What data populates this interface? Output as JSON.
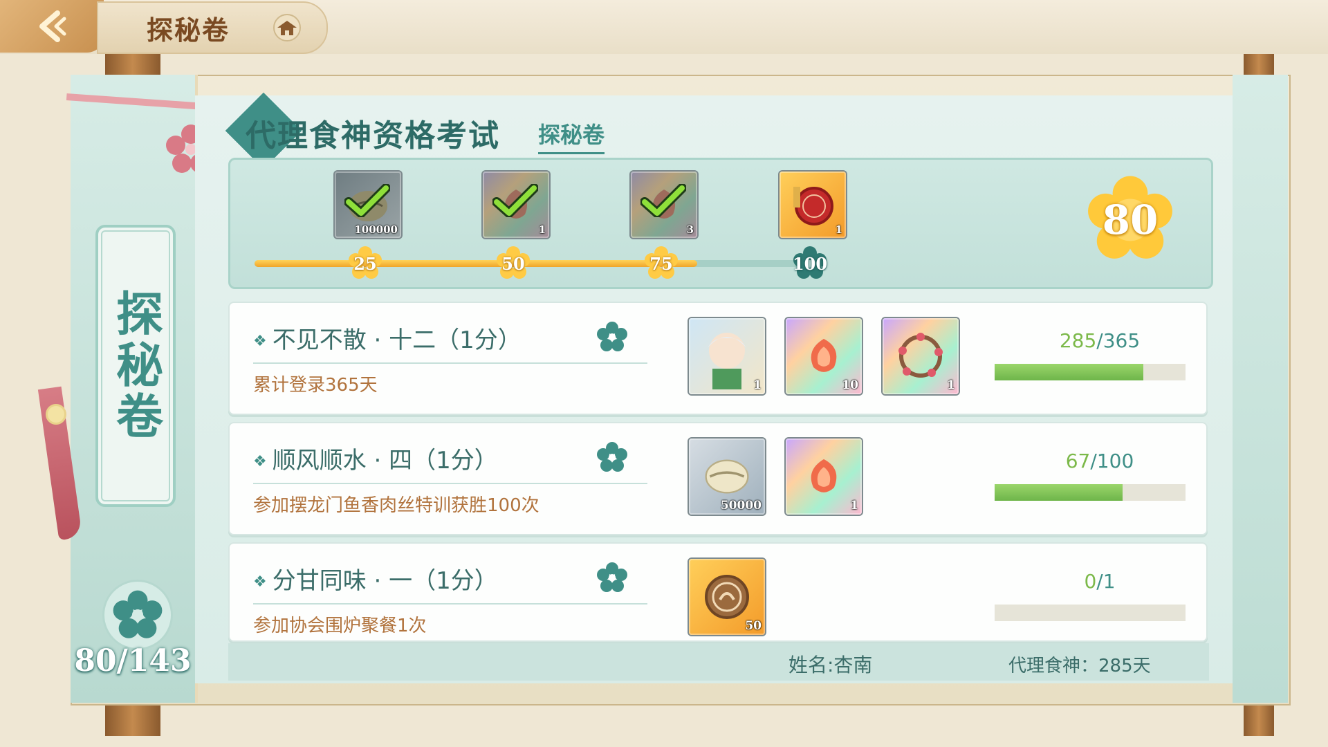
{
  "header": {
    "title": "探秘卷"
  },
  "sidebar": {
    "vertical_title": "探秘卷",
    "counter": "80/143"
  },
  "panel": {
    "title": "代理食神资格考试",
    "subtitle": "探秘卷"
  },
  "milestones": {
    "score": "80",
    "markers": [
      "25",
      "50",
      "75",
      "100"
    ],
    "progress_fraction": 0.8,
    "rewards": [
      {
        "qty": "100000",
        "claimed": true
      },
      {
        "qty": "1",
        "claimed": true
      },
      {
        "qty": "3",
        "claimed": true
      },
      {
        "qty": "1",
        "claimed": false
      }
    ]
  },
  "tasks": [
    {
      "name": "不见不散 · 十二（1分）",
      "desc": "累计登录365天",
      "progress_current": "285",
      "progress_total": "/365",
      "progress_fraction": 0.78,
      "rewards": [
        {
          "qty": "1"
        },
        {
          "qty": "10"
        },
        {
          "qty": "1"
        }
      ]
    },
    {
      "name": "顺风顺水 · 四（1分）",
      "desc": "参加摆龙门鱼香肉丝特训获胜100次",
      "progress_current": "67",
      "progress_total": "/100",
      "progress_fraction": 0.67,
      "rewards": [
        {
          "qty": "50000"
        },
        {
          "qty": "1"
        }
      ]
    },
    {
      "name": "分甘同味 · 一（1分）",
      "desc": "参加协会围炉聚餐1次",
      "progress_current": "0",
      "progress_total": "/1",
      "progress_fraction": 0,
      "rewards": [
        {
          "qty": "50"
        }
      ]
    }
  ],
  "footer": {
    "name": "姓名:杏南",
    "days": "代理食神：285天"
  },
  "colors": {
    "accent": "#3f8f87",
    "gold": "#f0a52a",
    "progress_green": "#7cb94a"
  }
}
